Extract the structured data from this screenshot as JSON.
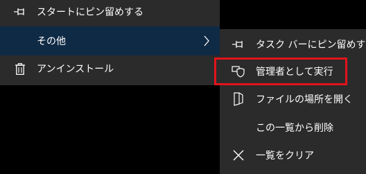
{
  "main_menu": {
    "items": [
      {
        "label": "スタートにピン留めする",
        "icon": "pin-icon"
      },
      {
        "label": "その他",
        "icon": "",
        "has_submenu": true
      },
      {
        "label": "アンインストール",
        "icon": "trash-icon"
      }
    ]
  },
  "sub_menu": {
    "items": [
      {
        "label": "タスク バーにピン留めする",
        "icon": "pin-icon"
      },
      {
        "label": "管理者として実行",
        "icon": "shield-icon"
      },
      {
        "label": "ファイルの場所を開く",
        "icon": "folder-open-icon"
      },
      {
        "label": "この一覧から削除",
        "icon": ""
      },
      {
        "label": "一覧をクリア",
        "icon": "close-icon"
      }
    ]
  },
  "colors": {
    "menu_background": "#2b2b2b",
    "selected_item_background": "#0f2a45",
    "highlight_box": "#e3131b",
    "text": "#ffffff",
    "desktop": "#000000"
  }
}
